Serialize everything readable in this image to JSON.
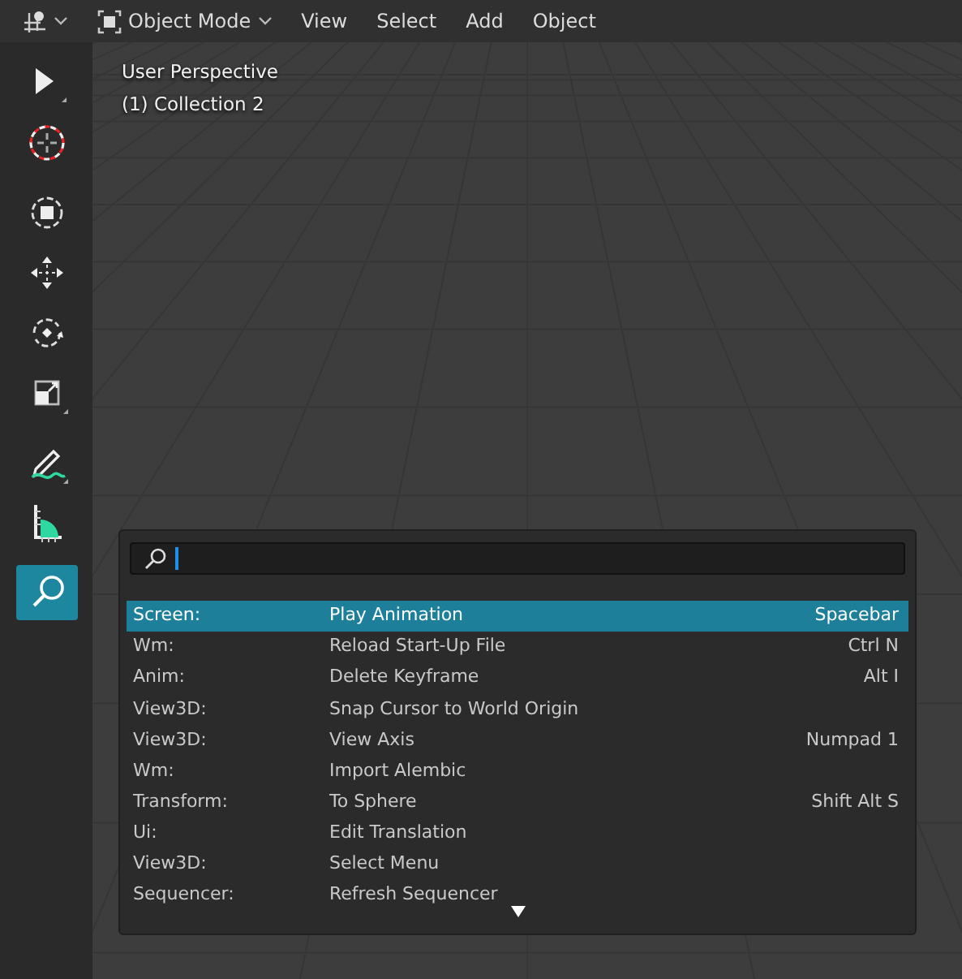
{
  "header": {
    "mode": "Object Mode",
    "menus": [
      "View",
      "Select",
      "Add",
      "Object"
    ]
  },
  "toolbar": [
    {
      "kind": "select",
      "selected": false
    },
    {
      "kind": "cursor",
      "selected": false
    },
    {
      "kind": "move-box",
      "selected": false
    },
    {
      "kind": "move",
      "selected": false
    },
    {
      "kind": "rotate",
      "selected": false
    },
    {
      "kind": "scale",
      "selected": false
    },
    {
      "kind": "annotate",
      "selected": false
    },
    {
      "kind": "measure",
      "selected": false
    },
    {
      "kind": "search",
      "selected": true
    }
  ],
  "viewport": {
    "overlay": [
      "User Perspective",
      "(1) Collection 2"
    ]
  },
  "search_popup": {
    "results": [
      {
        "category": "Screen:",
        "name": "Play Animation",
        "shortcut": "Spacebar",
        "selected": true
      },
      {
        "category": "Wm:",
        "name": "Reload Start-Up File",
        "shortcut": "Ctrl N",
        "selected": false
      },
      {
        "category": "Anim:",
        "name": "Delete Keyframe",
        "shortcut": "Alt I",
        "selected": false
      },
      {
        "category": "View3D:",
        "name": "Snap Cursor to World Origin",
        "selected": false
      },
      {
        "category": "View3D:",
        "name": "View Axis",
        "shortcut": "Numpad 1",
        "selected": false
      },
      {
        "category": "Wm:",
        "name": "Import Alembic",
        "selected": false
      },
      {
        "category": "Transform:",
        "name": "To Sphere",
        "shortcut": "Shift Alt S",
        "selected": false
      },
      {
        "category": "Ui:",
        "name": "Edit Translation",
        "selected": false
      },
      {
        "category": "View3D:",
        "name": "Select Menu",
        "selected": false
      },
      {
        "category": "Sequencer:",
        "name": "Refresh Sequencer",
        "selected": false
      }
    ],
    "more_below": true
  }
}
